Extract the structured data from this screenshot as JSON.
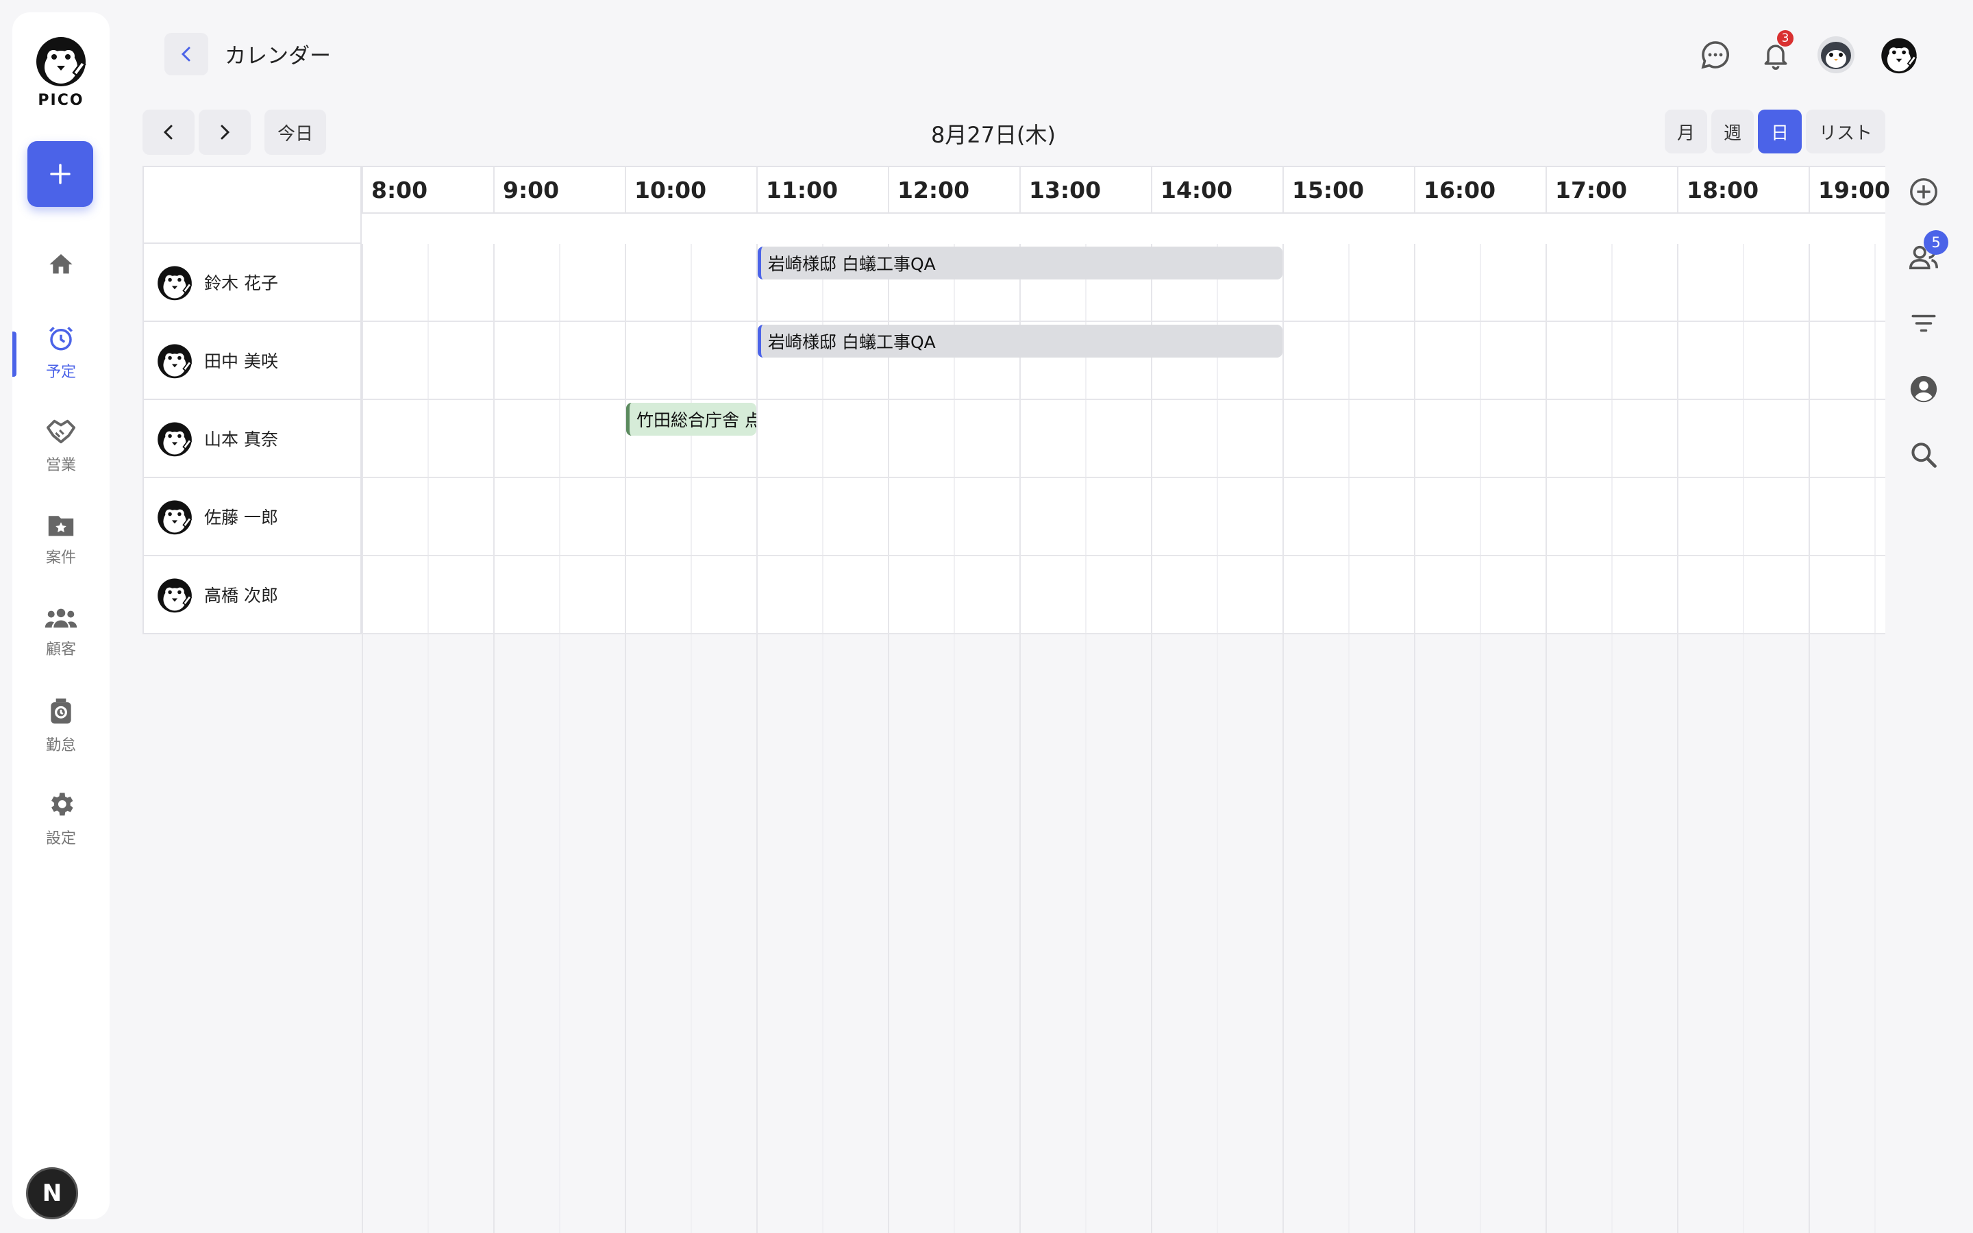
{
  "app": {
    "logo_text": "PICO",
    "page_title": "カレンダー"
  },
  "sidebar": {
    "items": [
      {
        "label": "",
        "icon": "home-icon"
      },
      {
        "label": "予定",
        "icon": "alarm-clock-icon"
      },
      {
        "label": "営業",
        "icon": "handshake-icon"
      },
      {
        "label": "案件",
        "icon": "folder-star-icon"
      },
      {
        "label": "顧客",
        "icon": "people-icon"
      },
      {
        "label": "勤怠",
        "icon": "timecard-icon"
      },
      {
        "label": "設定",
        "icon": "gear-icon"
      }
    ],
    "active": "予定",
    "bottom_badge": "N"
  },
  "header": {
    "notification_count": "3"
  },
  "toolbar": {
    "today_label": "今日",
    "date_title": "8月27日(木)",
    "views": [
      "月",
      "週",
      "日",
      "リスト"
    ],
    "active_view": "日"
  },
  "calendar": {
    "hours": [
      "8:00",
      "9:00",
      "10:00",
      "11:00",
      "12:00",
      "13:00",
      "14:00",
      "15:00",
      "16:00",
      "17:00",
      "18:00",
      "19:00"
    ],
    "resources": [
      "鈴木 花子",
      "田中 美咲",
      "山本 真奈",
      "佐藤 一郎",
      "高橋 次郎"
    ],
    "events": [
      {
        "resource": "鈴木 花子",
        "title": "岩崎様邸 白蟻工事QA",
        "start": "11:00",
        "end": "15:00",
        "color": "#4b63e8"
      },
      {
        "resource": "田中 美咲",
        "title": "岩崎様邸 白蟻工事QA",
        "start": "11:00",
        "end": "15:00",
        "color": "#4b63e8"
      },
      {
        "resource": "山本 真奈",
        "title": "竹田総合庁舎 点",
        "start": "10:00",
        "end": "11:00",
        "color": "#5b8a5e"
      }
    ]
  },
  "right_rail": {
    "member_count": "5"
  },
  "colors": {
    "accent": "#4b63e8",
    "notification": "#d93030",
    "event_gray": "#dcdde1",
    "event_green": "#d6ecd8"
  }
}
